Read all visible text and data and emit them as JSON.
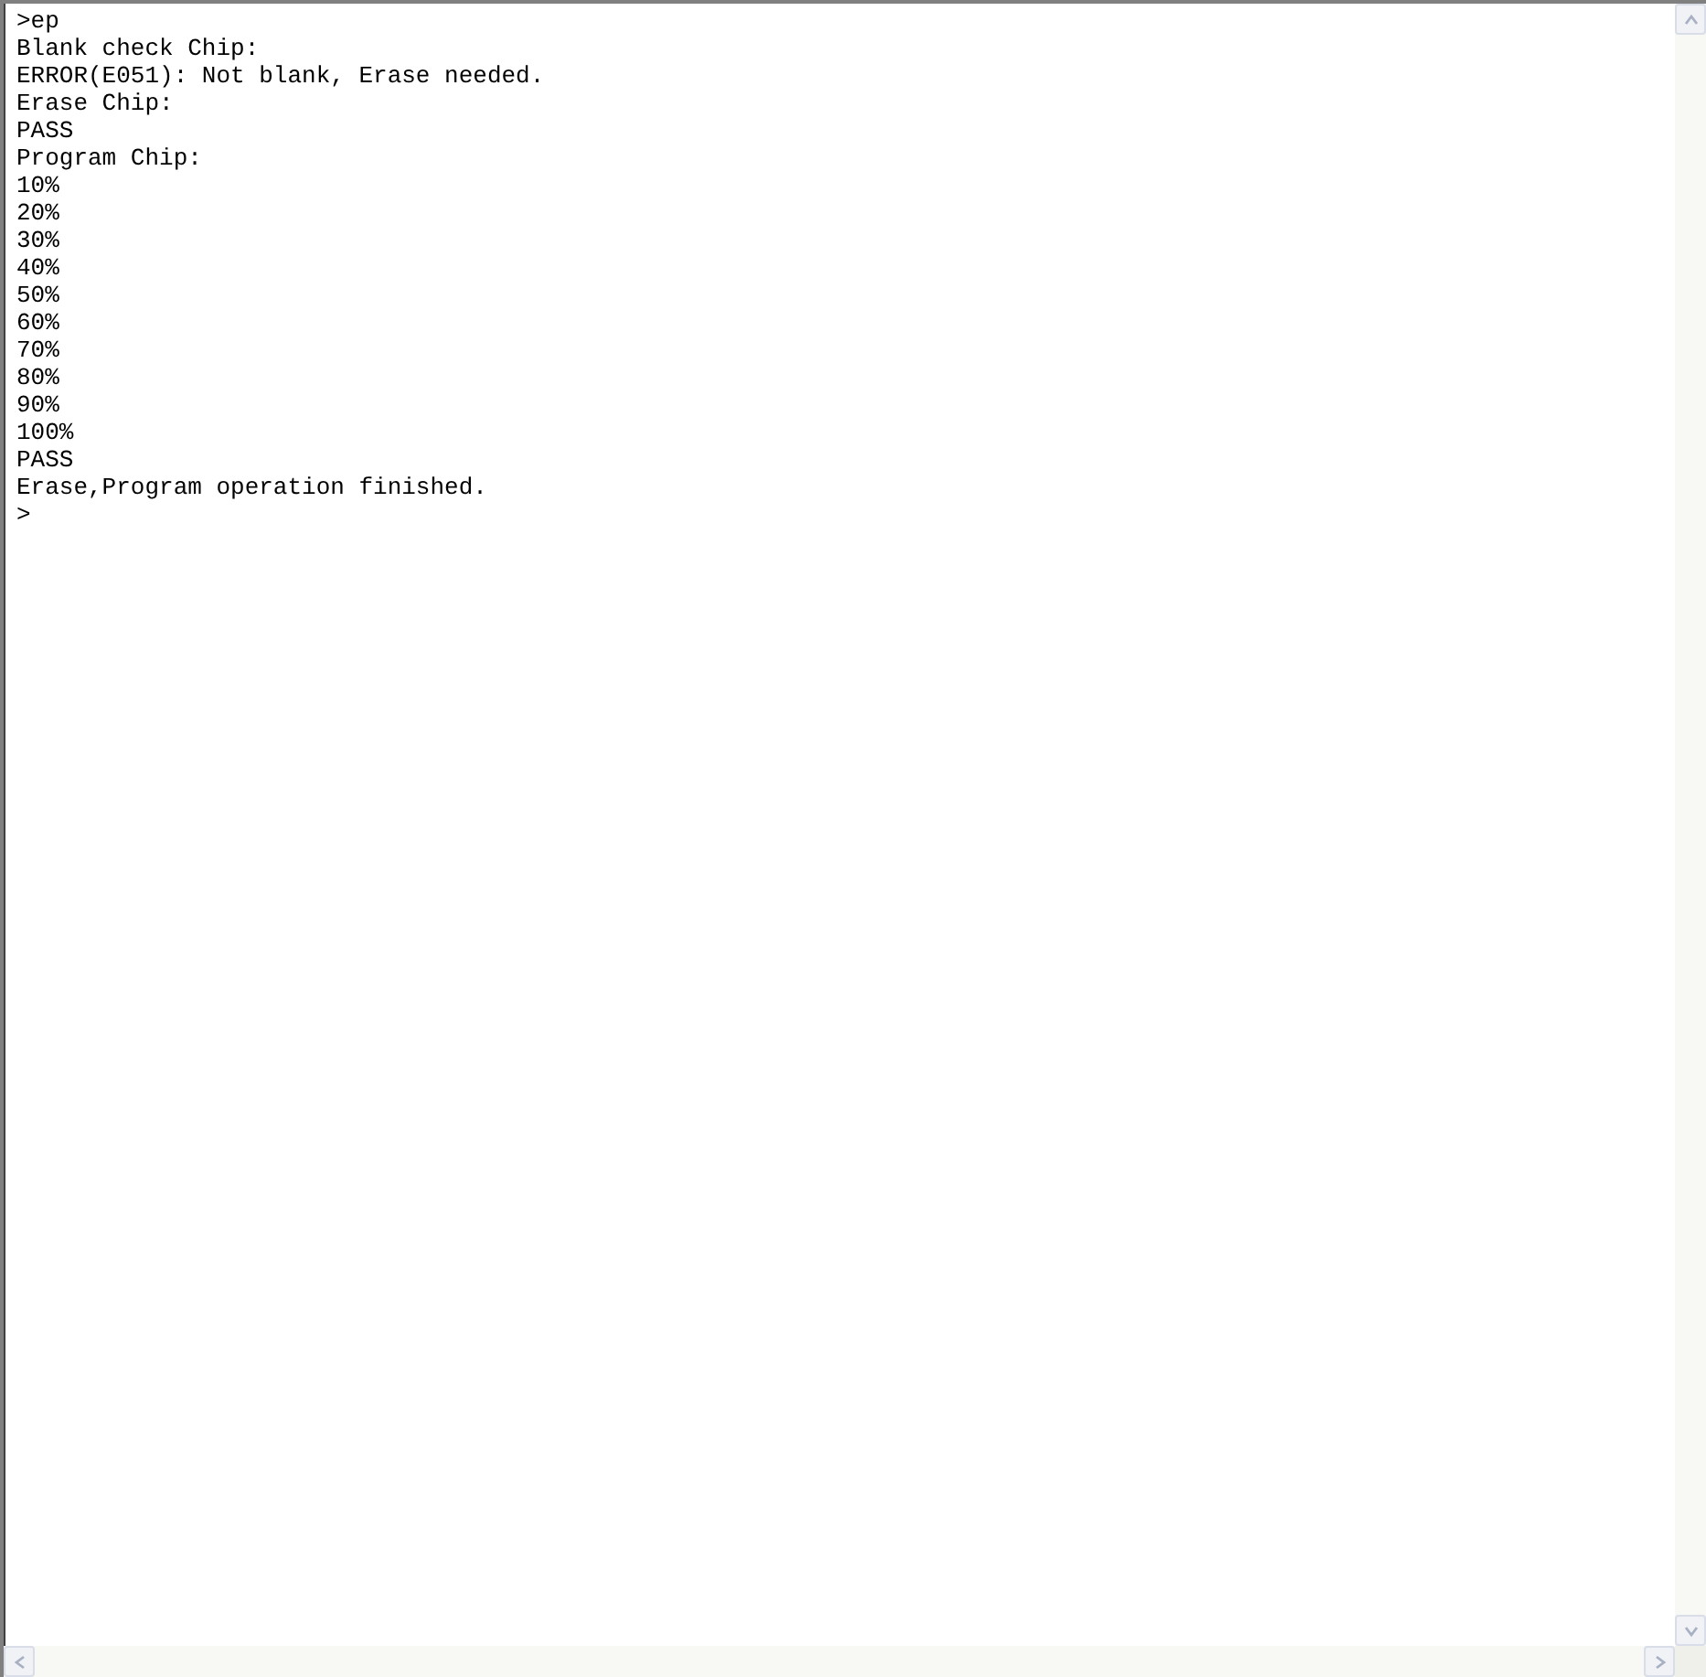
{
  "console": {
    "lines": [
      ">ep",
      "Blank check Chip:",
      "ERROR(E051): Not blank, Erase needed.",
      "Erase Chip:",
      "PASS",
      "Program Chip:",
      "10%",
      "20%",
      "30%",
      "40%",
      "50%",
      "60%",
      "70%",
      "80%",
      "90%",
      "100%",
      "PASS",
      "Erase,Program operation finished.",
      ">"
    ]
  }
}
